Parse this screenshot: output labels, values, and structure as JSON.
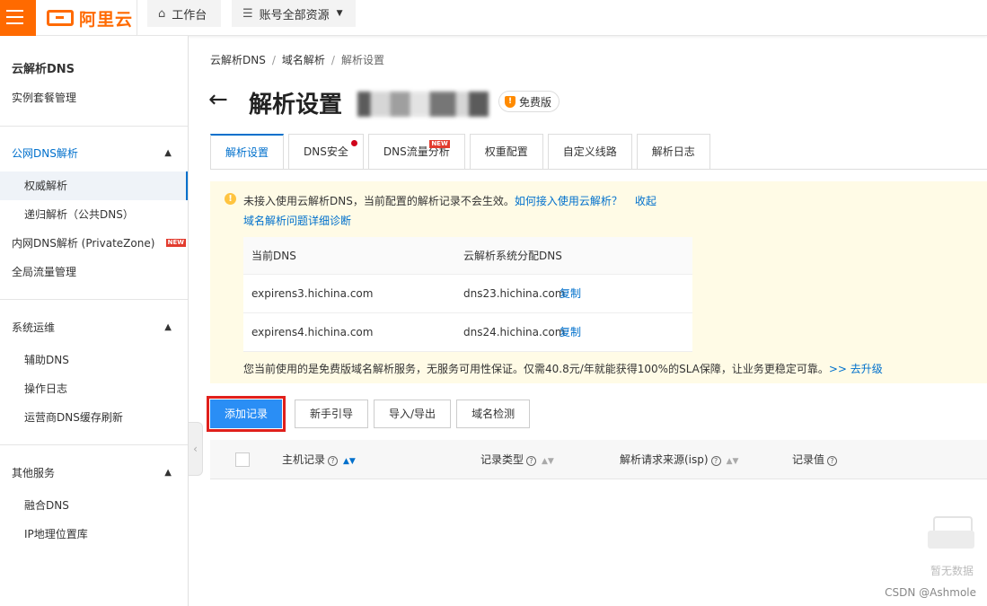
{
  "colors": {
    "brand": "#ff6a00",
    "link": "#0070cc",
    "primary_button": "#2a8ef5",
    "highlight_outline": "#e0201c",
    "notice_bg": "#fffbe6"
  },
  "topbar": {
    "logo_text": "阿里云",
    "workbench_label": "工作台",
    "resources_label": "账号全部资源"
  },
  "sidebar": {
    "title": "云解析DNS",
    "instance_mgmt": "实例套餐管理",
    "public_group": "公网DNS解析",
    "authoritative": "权威解析",
    "recursive": "递归解析（公共DNS）",
    "private_zone": "内网DNS解析 (PrivateZone)",
    "new_tag": "NEW",
    "global_traffic": "全局流量管理",
    "ops_group": "系统运维",
    "aux_dns": "辅助DNS",
    "op_log": "操作日志",
    "isp_cache": "运营商DNS缓存刷新",
    "other_group": "其他服务",
    "fusion_dns": "融合DNS",
    "ip_geo": "IP地理位置库"
  },
  "breadcrumb": {
    "items": [
      "云解析DNS",
      "域名解析",
      "解析设置"
    ],
    "sep": "/"
  },
  "header": {
    "title": "解析设置",
    "badge": "免费版"
  },
  "tabs": [
    {
      "label": "解析设置"
    },
    {
      "label": "DNS安全"
    },
    {
      "label": "DNS流量分析",
      "tag": "NEW"
    },
    {
      "label": "权重配置"
    },
    {
      "label": "自定义线路"
    },
    {
      "label": "解析日志"
    }
  ],
  "notice": {
    "text": "未接入使用云解析DNS，当前配置的解析记录不会生效。",
    "how_link": "如何接入使用云解析？",
    "collapse_link": "收起",
    "diagnose_link": "域名解析问题详细诊断",
    "table_head": {
      "current": "当前DNS",
      "assigned": "云解析系统分配DNS"
    },
    "rows": [
      {
        "current": "expirens3.hichina.com",
        "assigned": "dns23.hichina.com",
        "copy": "复制"
      },
      {
        "current": "expirens4.hichina.com",
        "assigned": "dns24.hichina.com",
        "copy": "复制"
      }
    ],
    "upgrade_text": "您当前使用的是免费版域名解析服务，无服务可用性保证。仅需40.8元/年就能获得100%的SLA保障，让业务更稳定可靠。",
    "upgrade_link": ">> 去升级"
  },
  "toolbar": {
    "add_record": "添加记录",
    "guide": "新手引导",
    "import_export": "导入/导出",
    "domain_check": "域名检测"
  },
  "records_table": {
    "columns": [
      "主机记录",
      "记录类型",
      "解析请求来源(isp)",
      "记录值"
    ],
    "empty_text": "暂无数据"
  },
  "watermark": "CSDN @Ashmole"
}
